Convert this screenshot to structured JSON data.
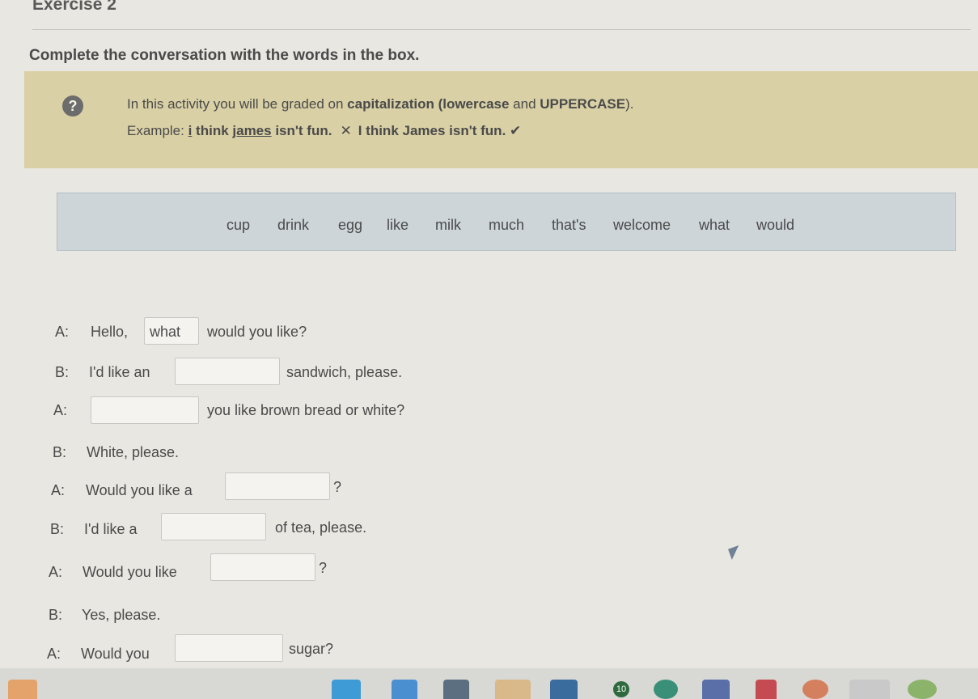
{
  "header": {
    "title": "Exercise 2",
    "instruction": "Complete the conversation with the words in the box."
  },
  "info": {
    "icon": "help-icon",
    "line1_text": "In this activity you will be graded on ",
    "line1_bold": "capitalization (lowercase",
    "line1_mid": " and ",
    "line1_upper": "UPPERCASE",
    "line1_end": ").",
    "example_label": "Example: ",
    "example_wrong_i": "i",
    "example_wrong_mid": " think ",
    "example_wrong_name": "james",
    "example_wrong_end": " isn't fun.",
    "wrong_mark": "✕",
    "example_right": "I think James isn't fun.",
    "right_mark": "✔"
  },
  "word_box": [
    "cup",
    "drink",
    "egg",
    "like",
    "milk",
    "much",
    "that's",
    "welcome",
    "what",
    "would"
  ],
  "dialogue": [
    {
      "speaker": "A:",
      "before": "Hello,",
      "value": "what",
      "after": "would you like?"
    },
    {
      "speaker": "B:",
      "before": "I'd like an",
      "value": "",
      "after": "sandwich, please."
    },
    {
      "speaker": "A:",
      "before": "",
      "value": "",
      "after": "you like brown bread or white?"
    },
    {
      "speaker": "B:",
      "before": "White, please.",
      "value": null,
      "after": ""
    },
    {
      "speaker": "A:",
      "before": "Would you like a",
      "value": "",
      "after": "?"
    },
    {
      "speaker": "B:",
      "before": "I'd like a",
      "value": "",
      "after": "of tea, please."
    },
    {
      "speaker": "A:",
      "before": "Would you like",
      "value": "",
      "after": "?"
    },
    {
      "speaker": "B:",
      "before": "Yes, please.",
      "value": null,
      "after": ""
    },
    {
      "speaker": "A:",
      "before": "Would you",
      "value": "",
      "after": "sugar?"
    }
  ],
  "taskbar": {
    "badge": "10"
  },
  "colors": {
    "info_bg": "#d9d0a5",
    "wordbox_bg": "#cdd5d9",
    "page_bg": "#e9e7e2"
  }
}
